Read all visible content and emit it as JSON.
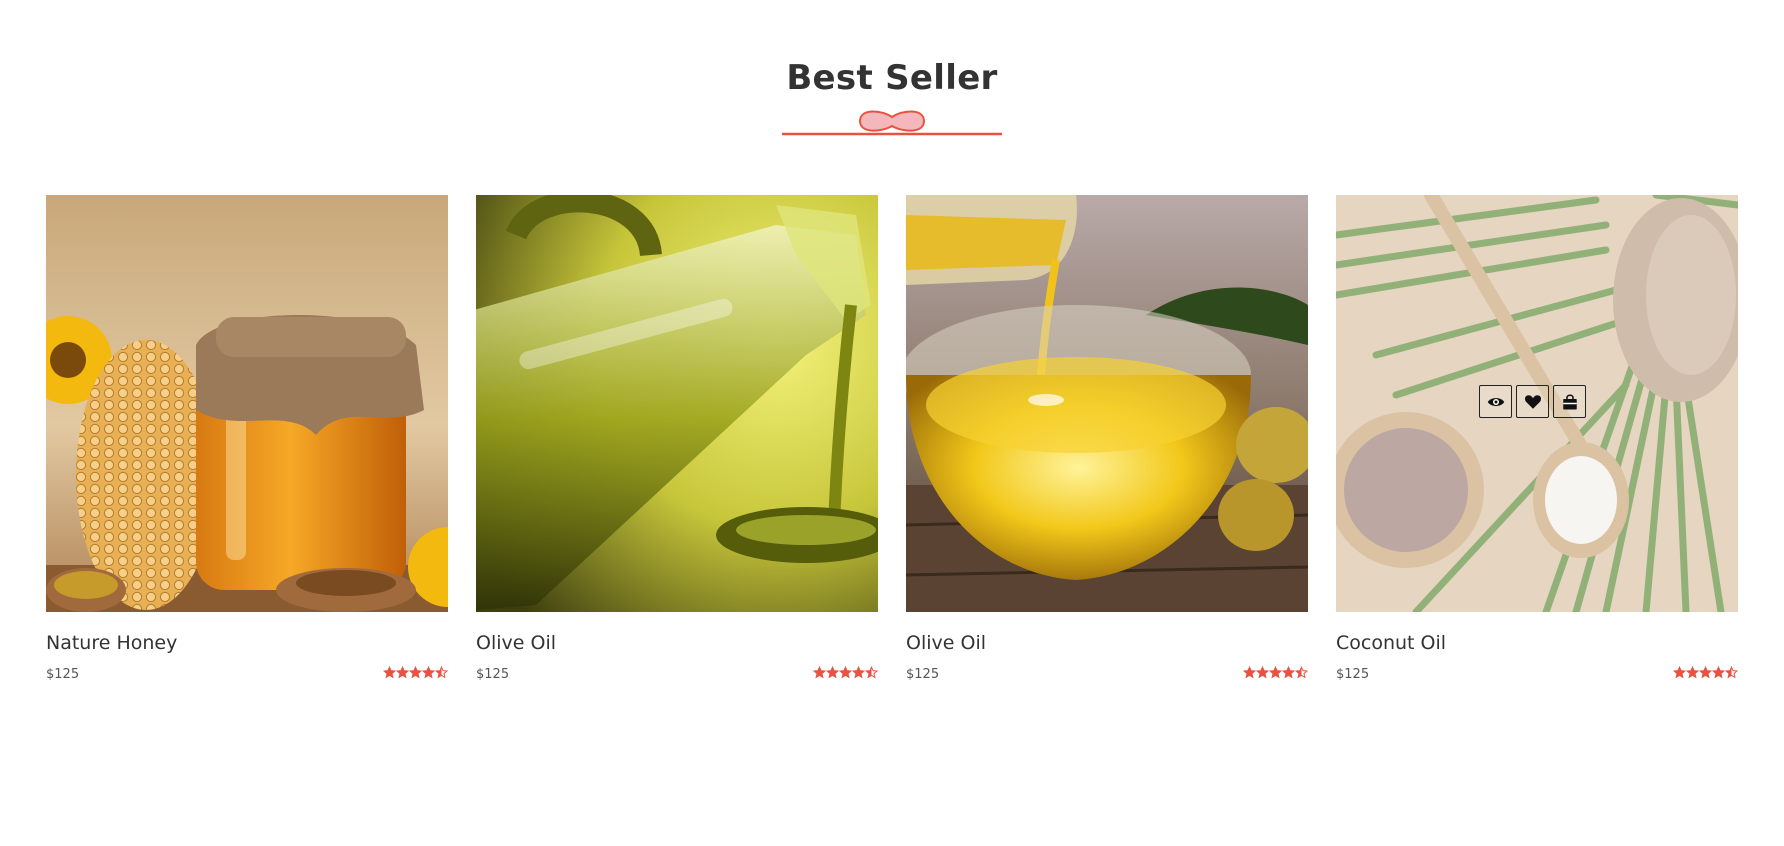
{
  "section": {
    "title": "Best Seller",
    "accent_color": "#e8523f",
    "ornament_fill": "#f4b7bc"
  },
  "products": [
    {
      "name": "Nature Honey",
      "price": "$125",
      "rating": 4.5,
      "image_icon": "honey-jar-photo"
    },
    {
      "name": "Olive Oil",
      "price": "$125",
      "rating": 4.5,
      "image_icon": "olive-oil-bottle-photo"
    },
    {
      "name": "Olive Oil",
      "price": "$125",
      "rating": 4.5,
      "image_icon": "olive-oil-bowl-photo"
    },
    {
      "name": "Coconut Oil",
      "price": "$125",
      "rating": 4.5,
      "image_icon": "coconut-oil-photo"
    }
  ],
  "quick_actions": [
    {
      "icon": "eye-icon",
      "action": "quick-view"
    },
    {
      "icon": "heart-icon",
      "action": "wishlist"
    },
    {
      "icon": "shopping-bag-icon",
      "action": "add-to-cart"
    }
  ]
}
